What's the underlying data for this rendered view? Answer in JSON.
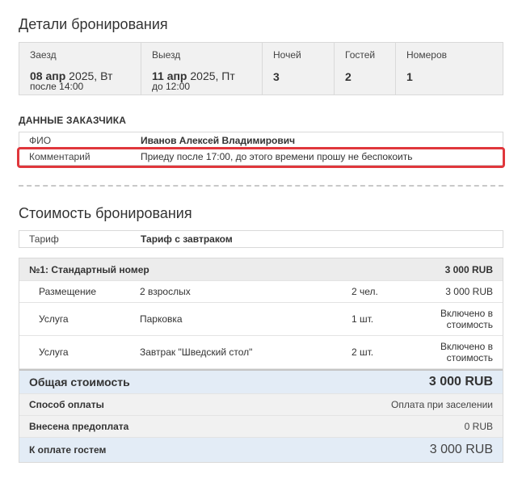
{
  "headings": {
    "details": "Детали бронирования",
    "cost": "Стоимость бронирования"
  },
  "dates": {
    "checkin_label": "Заезд",
    "checkin_day": "08 апр",
    "checkin_rest": " 2025, Вт",
    "checkin_time": "после 14:00",
    "checkout_label": "Выезд",
    "checkout_day": "11 апр",
    "checkout_rest": " 2025, Пт",
    "checkout_time": "до 12:00",
    "nights_label": "Ночей",
    "nights": "3",
    "guests_label": "Гостей",
    "guests": "2",
    "rooms_label": "Номеров",
    "rooms": "1"
  },
  "customer": {
    "section_title": "ДАННЫЕ ЗАКАЗЧИКА",
    "name_label": "ФИО",
    "name": "Иванов Алексей Владимирович",
    "comment_label": "Комментарий",
    "comment": "Приеду после 17:00, до этого времени прошу не беспокоить"
  },
  "highlight_color": "#e0373c",
  "tariff": {
    "label": "Тариф",
    "value": "Тариф с завтраком"
  },
  "room": {
    "title": "№1: Стандартный номер",
    "price": "3 000 RUB",
    "lines": [
      {
        "type": "Размещение",
        "desc": "2 взрослых",
        "qty": "2 чел.",
        "amount": "3 000 RUB"
      },
      {
        "type": "Услуга",
        "desc": "Парковка",
        "qty": "1 шт.",
        "amount": "Включено в стоимость"
      },
      {
        "type": "Услуга",
        "desc": "Завтрак \"Шведский стол\"",
        "qty": "2 шт.",
        "amount": "Включено в стоимость"
      }
    ]
  },
  "summary": {
    "total_label": "Общая стоимость",
    "total": "3 000 RUB",
    "payment_label": "Способ оплаты",
    "payment": "Оплата при заселении",
    "prepaid_label": "Внесена предоплата",
    "prepaid": "0 RUB",
    "due_label": "К оплате гостем",
    "due": "3 000 RUB"
  }
}
